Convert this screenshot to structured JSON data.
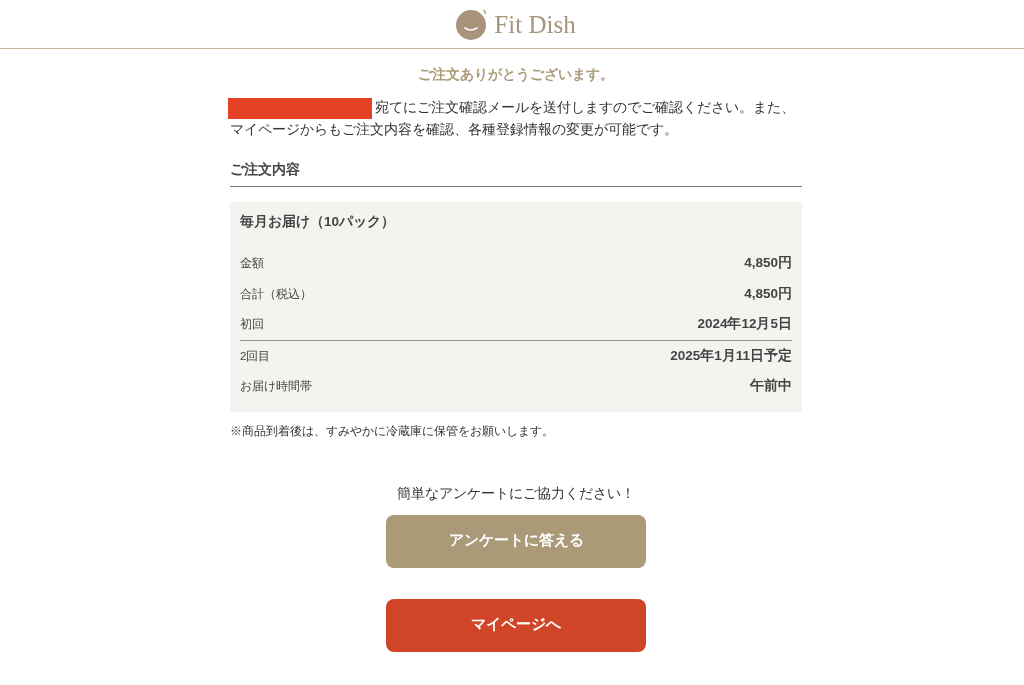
{
  "header": {
    "logo_text": "Fit Dish"
  },
  "thanks": "ご注文ありがとうございます。",
  "notice_lines": [
    "宛てにご注文確認メールを送付しますのでご確認ください。また、",
    "マイページからもご注文内容を確認、各種登録情報の変更が可能です。"
  ],
  "order": {
    "heading": "ご注文内容",
    "plan": "毎月お届け（10パック）",
    "row_groups": [
      [
        {
          "label": "金額",
          "value": "4,850円"
        },
        {
          "label": "合計（税込）",
          "value": "4,850円"
        },
        {
          "label": "初回",
          "value": "2024年12月5日"
        }
      ],
      [
        {
          "label": "2回目",
          "value": "2025年1月11日予定"
        },
        {
          "label": "お届け時間帯",
          "value": "午前中"
        }
      ]
    ],
    "note": "※商品到着後は、すみやかに冷蔵庫に保管をお願いします。"
  },
  "survey": {
    "prompt": "簡単なアンケートにご協力ください！",
    "button": "アンケートに答える"
  },
  "mypage_button": "マイページへ"
}
